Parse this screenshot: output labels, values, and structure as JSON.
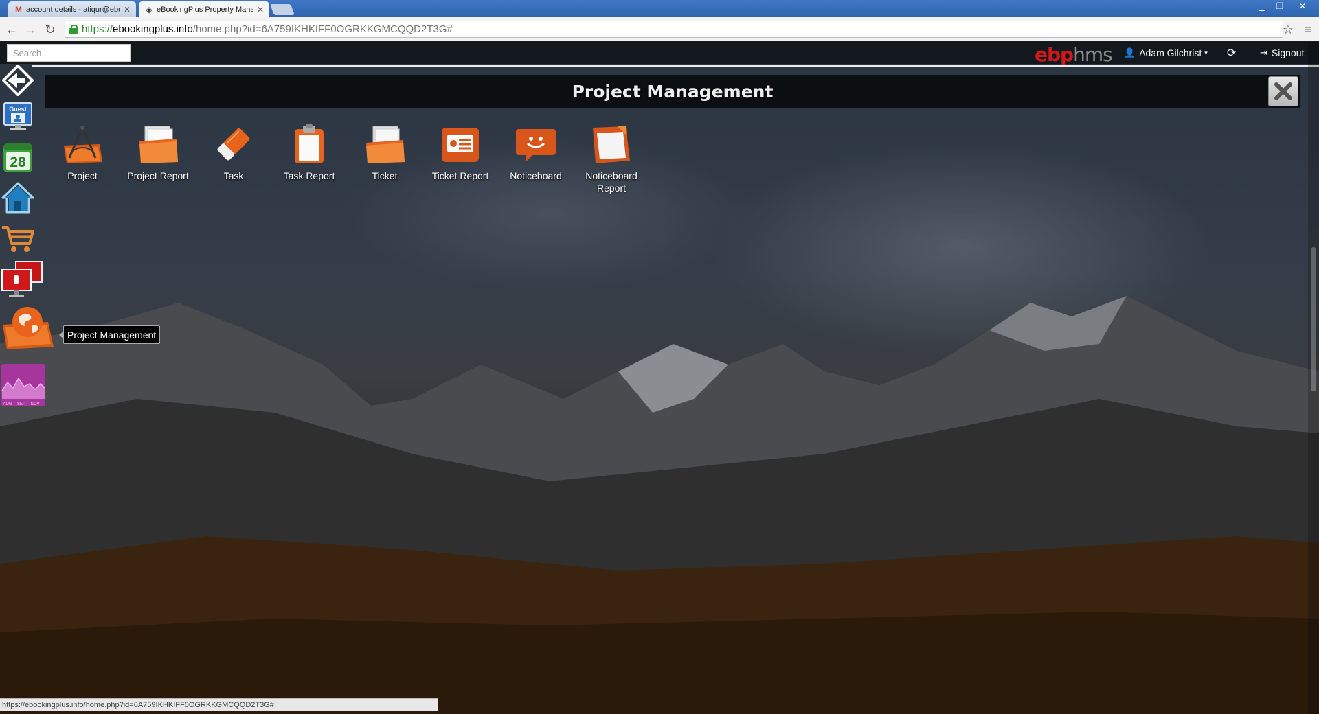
{
  "browser": {
    "tabs": [
      {
        "label": "account details - atiqur@ebo",
        "favicon": "gmail-icon",
        "active": false
      },
      {
        "label": "eBookingPlus Property Mana",
        "favicon": "site-icon",
        "active": true
      }
    ],
    "url": {
      "scheme": "https://",
      "host": "ebookingplus.info",
      "path": "/home.php?id=6A759IKHKIFF0OGRKKGMCQQD2T3G#"
    },
    "status_url": "https://ebookingplus.info/home.php?id=6A759IKHKIFF0OGRKKGMCQQD2T3G#"
  },
  "topbar": {
    "search_placeholder": "Search",
    "brand_part1": "ebp",
    "brand_part2": "hms",
    "user_name": "Adam Gilchrist",
    "signout_label": "Signout"
  },
  "dock": {
    "items": [
      {
        "name": "back-arrow-icon"
      },
      {
        "name": "guest-icon",
        "text": "Guest"
      },
      {
        "name": "calendar-icon",
        "text": "28"
      },
      {
        "name": "home-icon"
      },
      {
        "name": "shopping-cart-icon"
      },
      {
        "name": "presentation-icon"
      },
      {
        "name": "project-management-icon"
      },
      {
        "name": "analytics-chart-icon",
        "months": [
          "AUG",
          "SEP",
          "NOV"
        ]
      }
    ],
    "tooltip": "Project Management"
  },
  "window": {
    "title": "Project Management",
    "apps": [
      {
        "label": "Project",
        "icon": "project-compass-icon"
      },
      {
        "label": "Project Report",
        "icon": "folder-report-icon"
      },
      {
        "label": "Task",
        "icon": "task-eraser-icon"
      },
      {
        "label": "Task Report",
        "icon": "clipboard-icon"
      },
      {
        "label": "Ticket",
        "icon": "ticket-folder-icon"
      },
      {
        "label": "Ticket Report",
        "icon": "ticket-report-icon"
      },
      {
        "label": "Noticeboard",
        "icon": "noticeboard-chat-icon"
      },
      {
        "label": "Noticeboard Report",
        "icon": "noticeboard-report-icon"
      }
    ]
  },
  "colors": {
    "accent_orange": "#e8641c",
    "brand_red": "#d01818",
    "tab_bar_blue": "#3f78c6"
  }
}
